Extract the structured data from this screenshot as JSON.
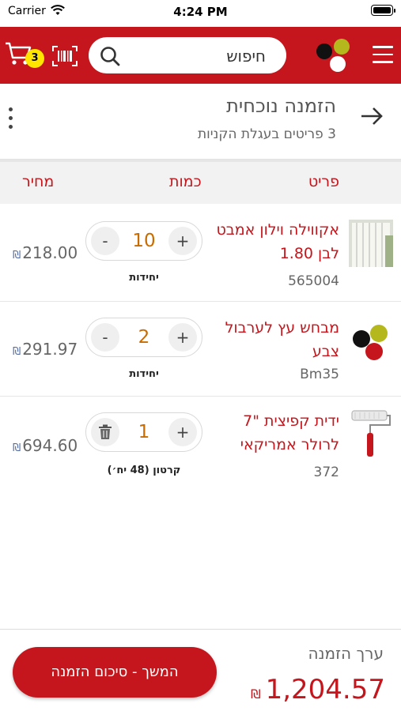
{
  "status_bar": {
    "carrier": "Carrier",
    "time": "4:24 PM"
  },
  "header": {
    "cart_count": "3",
    "search_placeholder": "חיפוש",
    "colors": {
      "brand": "#c4161c",
      "badge": "#ffe600"
    }
  },
  "order": {
    "title": "הזמנה נוכחית",
    "subtitle": "3 פריטים בעגלת הקניות"
  },
  "columns": {
    "item": "פריט",
    "quantity": "כמות",
    "price": "מחיר"
  },
  "items": [
    {
      "name": "אקווילה וילון אמבט לבן 1.80",
      "code": "565004",
      "quantity": "10",
      "unit": "יחידות",
      "price": "218.00",
      "currency": "₪",
      "left_action": "-",
      "thumb_icon": "shower-curtain-icon"
    },
    {
      "name": "מבחש עץ לערבול צבע",
      "code": "Bm35",
      "quantity": "2",
      "unit": "יחידות",
      "price": "291.97",
      "currency": "₪",
      "left_action": "-",
      "thumb_icon": "brand-logo-icon"
    },
    {
      "name": "ידית קפיצית \"7 לרולר אמריקאי",
      "code": "372",
      "quantity": "1",
      "unit": "קרטון (48 יח׳)",
      "price": "694.60",
      "currency": "₪",
      "left_action": "trash",
      "thumb_icon": "paint-roller-icon"
    }
  ],
  "footer": {
    "checkout_label": "המשך - סיכום הזמנה",
    "total_label": "ערך הזמנה",
    "total_value": "1,204.57",
    "currency": "₪"
  }
}
